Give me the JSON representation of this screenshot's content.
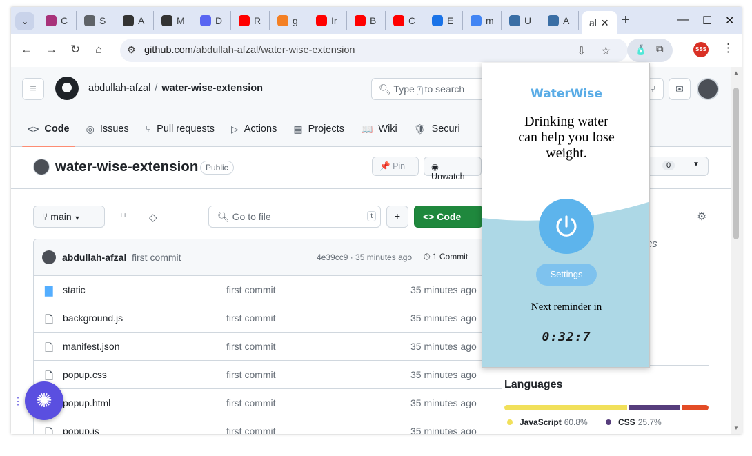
{
  "browser": {
    "tabs": [
      {
        "label": "C",
        "icon": "threads-icon",
        "color": "#a8327a"
      },
      {
        "label": "S",
        "icon": "mail-icon",
        "color": "#5f6368"
      },
      {
        "label": "A",
        "icon": "openai-icon",
        "color": "#333333"
      },
      {
        "label": "M",
        "icon": "openai-icon",
        "color": "#333333"
      },
      {
        "label": "D",
        "icon": "discord-icon",
        "color": "#5865f2"
      },
      {
        "label": "R",
        "icon": "youtube-icon",
        "color": "#ff0000"
      },
      {
        "label": "g",
        "icon": "stackoverflow-icon",
        "color": "#f48024"
      },
      {
        "label": "Ir",
        "icon": "youtube-icon",
        "color": "#ff0000"
      },
      {
        "label": "B",
        "icon": "youtube-icon",
        "color": "#ff0000"
      },
      {
        "label": "C",
        "icon": "youtube-icon",
        "color": "#ff0000"
      },
      {
        "label": "E",
        "icon": "puzzle-icon",
        "color": "#1a73e8"
      },
      {
        "label": "m",
        "icon": "google-icon",
        "color": "#4285f4"
      },
      {
        "label": "U",
        "icon": "site-icon",
        "color": "#3a6ea5"
      },
      {
        "label": "A",
        "icon": "site-icon",
        "color": "#3a6ea5"
      }
    ],
    "active_tab": {
      "label": "al"
    },
    "url_host": "github.com",
    "url_path": "/abdullah-afzal/water-wise-extension",
    "profile_badge": "SSS"
  },
  "github": {
    "owner": "abdullah-afzal",
    "repo": "water-wise-extension",
    "search_prefix": "Type",
    "search_key": "/",
    "search_suffix": "to search",
    "nav": [
      {
        "label": "Code",
        "icon": "<>"
      },
      {
        "label": "Issues",
        "icon": "◎"
      },
      {
        "label": "Pull requests",
        "icon": "⑂"
      },
      {
        "label": "Actions",
        "icon": "▷"
      },
      {
        "label": "Projects",
        "icon": "▦"
      },
      {
        "label": "Wiki",
        "icon": "📖"
      },
      {
        "label": "Securi",
        "icon": "🛡"
      }
    ],
    "visibility": "Public",
    "pin_label": "Pin",
    "unwatch_label": "Unwatch",
    "star_label": "tar",
    "star_count": "0",
    "branch": "main",
    "goto_placeholder": "Go to file",
    "goto_key": "t",
    "code_label": "Code",
    "commit": {
      "author": "abdullah-afzal",
      "message": "first commit",
      "meta": "4e39cc9 · 35 minutes ago",
      "count": "1 Commit"
    },
    "files": [
      {
        "name": "static",
        "msg": "first commit",
        "age": "35 minutes ago",
        "dir": true
      },
      {
        "name": "background.js",
        "msg": "first commit",
        "age": "35 minutes ago",
        "dir": false
      },
      {
        "name": "manifest.json",
        "msg": "first commit",
        "age": "35 minutes ago",
        "dir": false
      },
      {
        "name": "popup.css",
        "msg": "first commit",
        "age": "35 minutes ago",
        "dir": false
      },
      {
        "name": "popup.html",
        "msg": "first commit",
        "age": "35 minutes ago",
        "dir": false
      },
      {
        "name": "popup.js",
        "msg": "first commit",
        "age": "35 minutes ago",
        "dir": false
      }
    ],
    "about_topics": "pics",
    "languages_title": "Languages",
    "languages": [
      {
        "name": "JavaScript",
        "pct": "60.8%",
        "value": 60.8,
        "color": "#f1e05a"
      },
      {
        "name": "CSS",
        "pct": "25.7%",
        "value": 25.7,
        "color": "#563d7c"
      },
      {
        "name": "HTML",
        "pct": "13.5%",
        "value": 13.5,
        "color": "#e34c26"
      }
    ]
  },
  "popup": {
    "title": "WaterWise",
    "tip": "Drinking water can help you lose weight.",
    "settings_label": "Settings",
    "next_label": "Next reminder in",
    "timer": "0:32:7"
  }
}
